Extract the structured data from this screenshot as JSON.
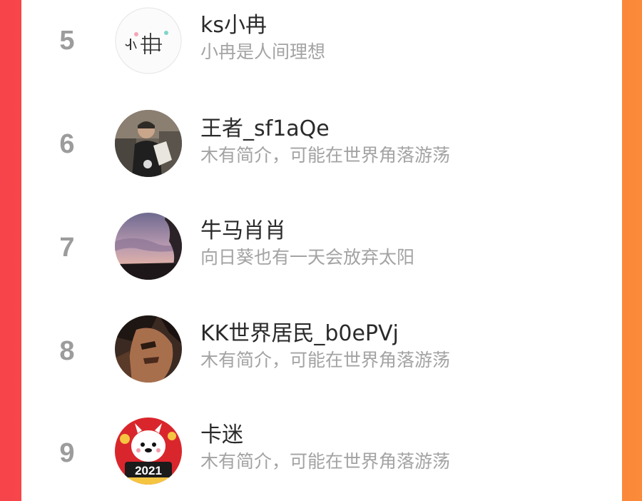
{
  "colors": {
    "background_left": "#f7434a",
    "background_right": "#fb8a3a",
    "rank": "#9c9c9c",
    "name": "#2a2a2a",
    "bio": "#a3a3a3"
  },
  "users": [
    {
      "rank": "5",
      "name": "ks小冉",
      "bio": "小冉是人间理想",
      "avatar_icon": "handwritten-xiaoran-avatar"
    },
    {
      "rank": "6",
      "name": "王者_sf1aQe",
      "bio": "木有简介，可能在世界角落游荡",
      "avatar_icon": "street-photo-avatar"
    },
    {
      "rank": "7",
      "name": "牛马肖肖",
      "bio": "向日葵也有一天会放弃太阳",
      "avatar_icon": "sunset-sky-avatar"
    },
    {
      "rank": "8",
      "name": "KK世界居民_b0ePVj",
      "bio": "木有简介，可能在世界角落游荡",
      "avatar_icon": "anime-character-avatar"
    },
    {
      "rank": "9",
      "name": "卡迷",
      "bio": "木有简介，可能在世界角落游荡",
      "avatar_icon": "cartoon-2021-avatar"
    }
  ]
}
